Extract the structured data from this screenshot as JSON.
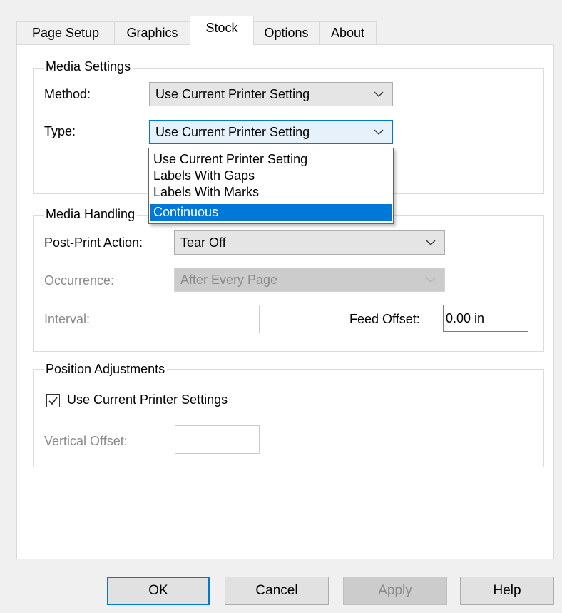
{
  "tabs": [
    {
      "label": "Page Setup"
    },
    {
      "label": "Graphics"
    },
    {
      "label": "Stock"
    },
    {
      "label": "Options"
    },
    {
      "label": "About"
    }
  ],
  "active_tab": "Stock",
  "media_settings": {
    "title": "Media Settings",
    "method_label": "Method:",
    "method_value": "Use Current Printer Setting",
    "type_label": "Type:",
    "type_value": "Use Current Printer Setting",
    "type_options": [
      "Use Current Printer Setting",
      "Labels With Gaps",
      "Labels With Marks",
      "Continuous"
    ],
    "type_highlighted": "Continuous"
  },
  "media_handling": {
    "title": "Media Handling",
    "post_print_label": "Post-Print Action:",
    "post_print_value": "Tear Off",
    "occurrence_label": "Occurrence:",
    "occurrence_value": "After Every Page",
    "interval_label": "Interval:",
    "interval_value": "",
    "feed_offset_label": "Feed Offset:",
    "feed_offset_value": "0.00 in"
  },
  "position_adjustments": {
    "title": "Position Adjustments",
    "use_current_label": "Use Current Printer Settings",
    "use_current_checked": true,
    "vertical_offset_label": "Vertical Offset:",
    "vertical_offset_value": ""
  },
  "buttons": {
    "ok": "OK",
    "cancel": "Cancel",
    "apply": "Apply",
    "help": "Help"
  },
  "colors": {
    "accent": "#0078d7",
    "disabled_text": "#8a8a8a"
  }
}
